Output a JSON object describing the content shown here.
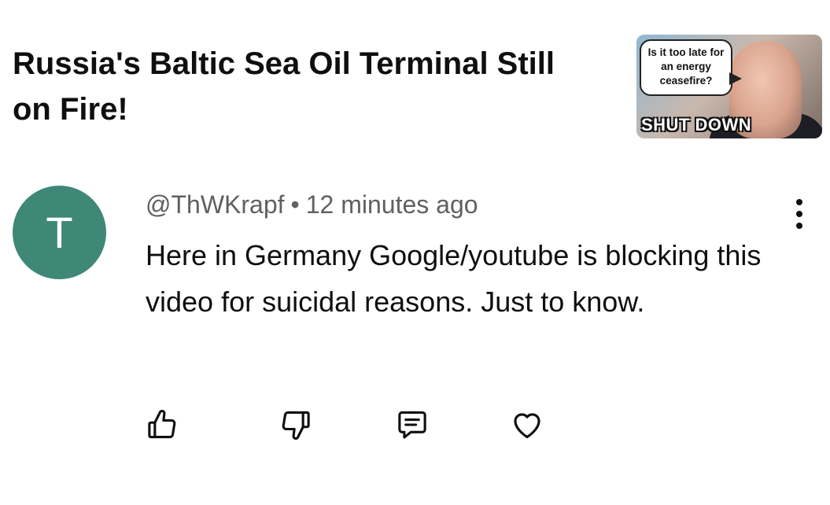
{
  "video": {
    "title": "Russia's Baltic Sea Oil Terminal Still on Fire!",
    "thumbnail": {
      "bubble_text": "Is it too late for an energy ceasefire?",
      "banner_text": "SHUT DOWN"
    }
  },
  "comment": {
    "avatar_letter": "T",
    "avatar_color": "#3f8878",
    "author": "@ThWKrapf",
    "separator": "•",
    "timestamp": "12 minutes ago",
    "text": "Here in Germany Google/youtube is blocking this video for suicidal reasons. Just to know.",
    "more_icon": "more-vert-icon"
  },
  "actions": [
    {
      "name": "like",
      "icon": "thumbs-up-icon"
    },
    {
      "name": "dislike",
      "icon": "thumbs-down-icon"
    },
    {
      "name": "reply",
      "icon": "reply-comment-icon"
    },
    {
      "name": "heart",
      "icon": "heart-icon"
    }
  ]
}
